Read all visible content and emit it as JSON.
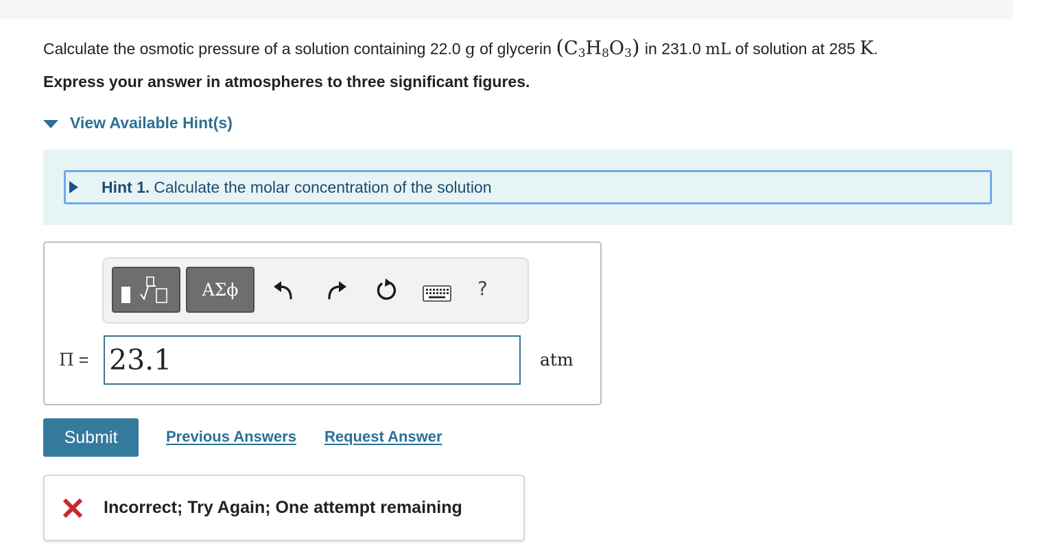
{
  "question": {
    "prefix": "Calculate the osmotic pressure of a solution containing 22.0",
    "mass_unit": "g",
    "middle": "of glycerin",
    "formula": {
      "open": "(",
      "c": "C",
      "c_sub": "3",
      "h": "H",
      "h_sub": "8",
      "o": "O",
      "o_sub": "3",
      "close": ")"
    },
    "volume_text": "in 231.0",
    "volume_unit": "mL",
    "temp_text": "of solution at 285",
    "temp_unit": "K",
    "end": "."
  },
  "instructions": "Express your answer in atmospheres to three significant figures.",
  "hints": {
    "toggle_label": "View Available Hint(s)",
    "items": [
      {
        "number": "Hint 1.",
        "text": "Calculate the molar concentration of the solution"
      }
    ]
  },
  "toolbar": {
    "greek_label": "ΑΣϕ",
    "help_label": "?",
    "icons": [
      "templates-icon",
      "undo-icon",
      "redo-icon",
      "reset-icon",
      "keyboard-icon",
      "help-icon"
    ]
  },
  "answer": {
    "variable": "Π",
    "equals": "=",
    "value": "23.1",
    "unit": "atm"
  },
  "actions": {
    "submit": "Submit",
    "previous_answers": "Previous Answers",
    "request_answer": "Request Answer"
  },
  "feedback": {
    "text": "Incorrect; Try Again; One attempt remaining",
    "status_color": "#c9292c"
  },
  "colors": {
    "link": "#2a7095",
    "submit_bg": "#347a9d",
    "hint_panel_bg": "#e7f4f6",
    "hint_border": "#6ea9e9",
    "input_border": "#3c7592"
  }
}
